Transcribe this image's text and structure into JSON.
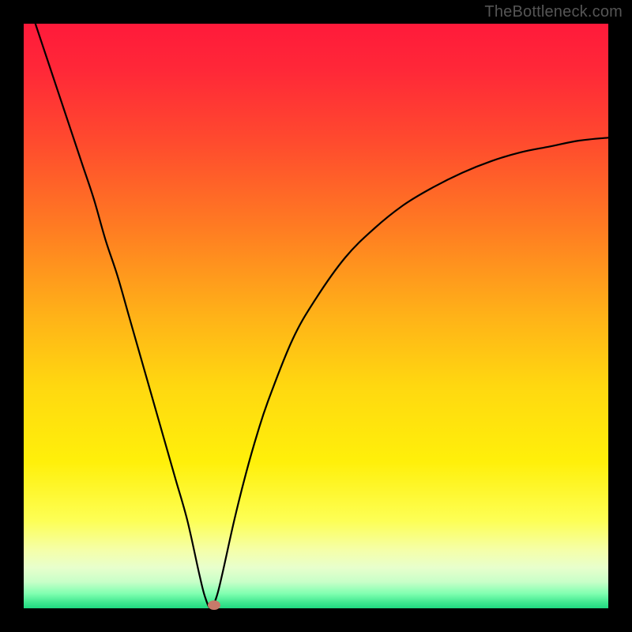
{
  "watermark": "TheBottleneck.com",
  "chart_data": {
    "type": "line",
    "title": "",
    "xlabel": "",
    "ylabel": "",
    "xlim": [
      0,
      100
    ],
    "ylim": [
      0,
      100
    ],
    "series": [
      {
        "name": "bottleneck-curve",
        "x": [
          2,
          4,
          6,
          8,
          10,
          12,
          14,
          16,
          18,
          20,
          22,
          24,
          26,
          28,
          30,
          31,
          32,
          33,
          34,
          36,
          38,
          40,
          42,
          46,
          50,
          55,
          60,
          65,
          70,
          75,
          80,
          85,
          90,
          95,
          100
        ],
        "values": [
          100,
          94,
          88,
          82,
          76,
          70,
          63,
          57,
          50,
          43,
          36,
          29,
          22,
          15,
          6,
          2,
          0,
          2,
          6,
          15,
          23,
          30,
          36,
          46,
          53,
          60,
          65,
          69,
          72,
          74.5,
          76.5,
          78,
          79,
          80,
          80.5
        ]
      }
    ],
    "marker": {
      "x": 32.5,
      "y": 0.5,
      "color": "#c77a6a"
    },
    "gradient_stops": [
      {
        "offset": 0,
        "color": "#ff1a3a"
      },
      {
        "offset": 0.08,
        "color": "#ff2838"
      },
      {
        "offset": 0.2,
        "color": "#ff4a2e"
      },
      {
        "offset": 0.35,
        "color": "#ff7c22"
      },
      {
        "offset": 0.5,
        "color": "#ffb218"
      },
      {
        "offset": 0.62,
        "color": "#ffd810"
      },
      {
        "offset": 0.75,
        "color": "#fff00a"
      },
      {
        "offset": 0.85,
        "color": "#fdff55"
      },
      {
        "offset": 0.9,
        "color": "#f5ffa8"
      },
      {
        "offset": 0.93,
        "color": "#e8ffcc"
      },
      {
        "offset": 0.955,
        "color": "#c8ffc8"
      },
      {
        "offset": 0.975,
        "color": "#80ffb0"
      },
      {
        "offset": 0.99,
        "color": "#40e890"
      },
      {
        "offset": 1.0,
        "color": "#20d880"
      }
    ]
  }
}
